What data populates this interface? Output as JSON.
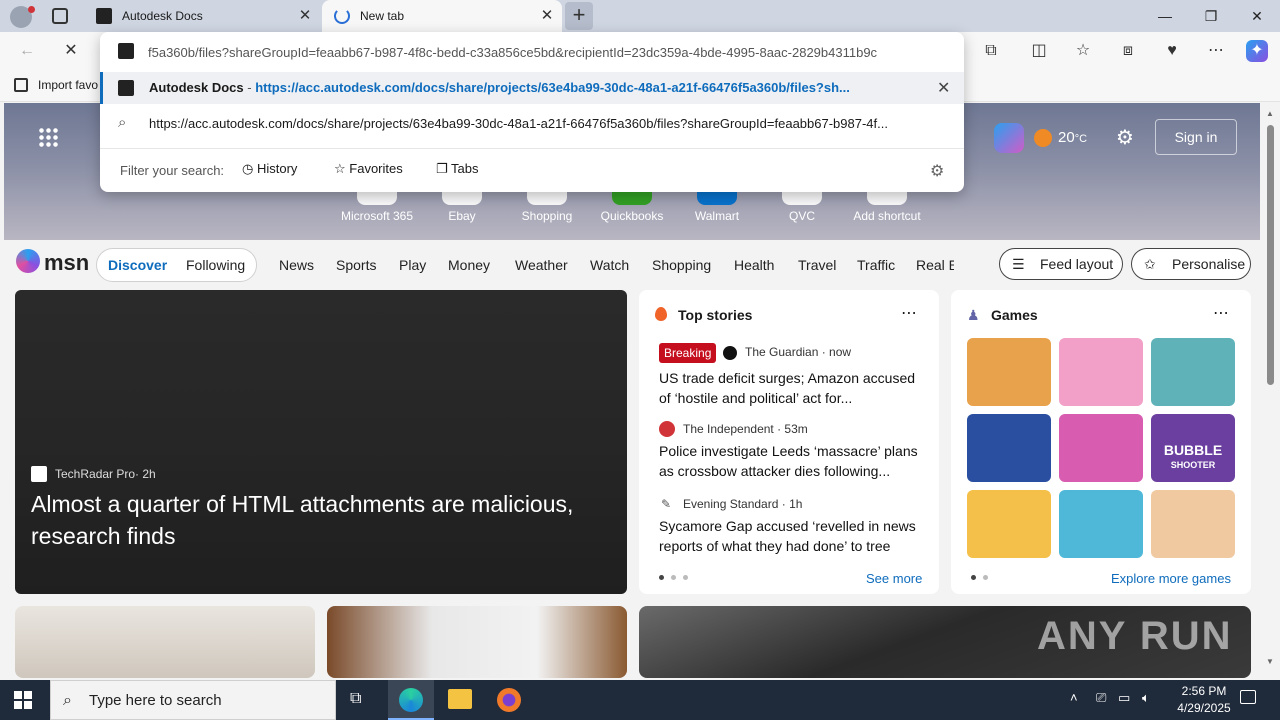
{
  "tabs": [
    {
      "title": "Autodesk Docs"
    },
    {
      "title": "New tab"
    }
  ],
  "address": {
    "value": "f5a360b/files?shareGroupId=feaabb67-b987-4f8c-bedd-c33a856ce5bd&recipientId=23dc359a-4bde-4995-8aac-2829b4311b9c"
  },
  "suggestions": [
    {
      "title": "Autodesk Docs",
      "sep": " - ",
      "url": "https://acc.autodesk.com/docs/share/projects/63e4ba99-30dc-48a1-a21f-66476f5a360b/files?sh..."
    },
    {
      "text": "https://acc.autodesk.com/docs/share/projects/63e4ba99-30dc-48a1-a21f-66476f5a360b/files?shareGroupId=feaabb67-b987-4f..."
    }
  ],
  "filter": {
    "label": "Filter your search:",
    "history": "History",
    "favorites": "Favorites",
    "tabs": "Tabs"
  },
  "favbar": {
    "import": "Import favo"
  },
  "hero": {
    "temp": "20",
    "unit": "°C",
    "signin": "Sign in",
    "shortcuts": [
      "Microsoft 365",
      "Ebay",
      "Shopping",
      "Quickbooks",
      "Walmart",
      "QVC",
      "Add shortcut"
    ]
  },
  "msn": {
    "logo": "msn",
    "discover": "Discover",
    "following": "Following",
    "nav": [
      "News",
      "Sports",
      "Play",
      "Money",
      "Weather",
      "Watch",
      "Shopping",
      "Health",
      "Travel",
      "Traffic",
      "Real E"
    ],
    "feed_layout": "Feed layout",
    "personalise": "Personalise"
  },
  "bigcard": {
    "source": "TechRadar Pro",
    "age": "2h",
    "headline": "Almost a quarter of HTML attachments are malicious, research finds"
  },
  "topstories": {
    "heading": "Top stories",
    "breaking": "Breaking",
    "stories": [
      {
        "source": "The Guardian · now",
        "title": "US trade deficit surges; Amazon accused of ‘hostile and political’ act for..."
      },
      {
        "source": "The Independent · 53m",
        "title": "Police investigate Leeds ‘massacre’ plans as crossbow attacker dies following..."
      },
      {
        "source": "Evening Standard · 1h",
        "title": "Sycamore Gap accused ‘revelled in news reports of what they had done’ to tree"
      }
    ],
    "see_more": "See more"
  },
  "games": {
    "heading": "Games",
    "explore": "Explore more games",
    "bubble_line1": "BUBBLE",
    "bubble_line2": "SHOOTER",
    "tiles": [
      "#e8a24b",
      "#f2a0c8",
      "#5fb3b8",
      "#2b4fa0",
      "#d85db0",
      "#6a3fa0",
      "#f5c04a",
      "#4fb8d8",
      "#f0c9a0"
    ]
  },
  "taskbar": {
    "search_placeholder": "Type here to search",
    "time": "2:56 PM",
    "date": "4/29/2025"
  },
  "watermark": "ANY RUN",
  "colors": {
    "accent": "#0f6cbd",
    "breaking": "#c50f1f"
  }
}
